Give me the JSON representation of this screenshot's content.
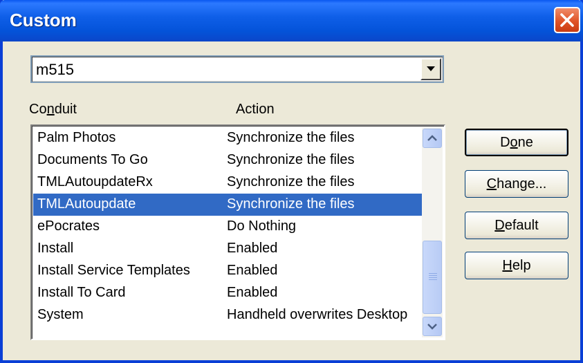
{
  "window": {
    "title": "Custom"
  },
  "device_combo": {
    "value": "m515"
  },
  "columns": {
    "conduit": "Conduit",
    "action": "Action"
  },
  "rows": [
    {
      "conduit": "Palm Photos",
      "action": "Synchronize the files",
      "selected": false
    },
    {
      "conduit": "Documents To Go",
      "action": "Synchronize the files",
      "selected": false
    },
    {
      "conduit": "TMLAutoupdateRx",
      "action": "Synchronize the files",
      "selected": false
    },
    {
      "conduit": "TMLAutoupdate",
      "action": "Synchronize the files",
      "selected": true
    },
    {
      "conduit": "ePocrates",
      "action": "Do Nothing",
      "selected": false
    },
    {
      "conduit": "Install",
      "action": "Enabled",
      "selected": false
    },
    {
      "conduit": "Install Service Templates",
      "action": "Enabled",
      "selected": false
    },
    {
      "conduit": "Install To Card",
      "action": "Enabled",
      "selected": false
    },
    {
      "conduit": "System",
      "action": "Handheld overwrites Desktop",
      "selected": false
    }
  ],
  "buttons": {
    "done": {
      "pre": "D",
      "key": "o",
      "post": "ne"
    },
    "change": {
      "pre": "",
      "key": "C",
      "post": "hange..."
    },
    "default": {
      "pre": "",
      "key": "D",
      "post": "efault"
    },
    "help": {
      "pre": "",
      "key": "H",
      "post": "elp"
    }
  },
  "icons": {
    "close": "close-icon",
    "dropdown": "chevron-down-icon",
    "scroll_up": "scroll-up-icon",
    "scroll_down": "scroll-down-icon"
  },
  "colors": {
    "titlebar": "#0453d9",
    "selection": "#316ac5",
    "close_button": "#e05428",
    "dialog_bg": "#ece9d8"
  }
}
